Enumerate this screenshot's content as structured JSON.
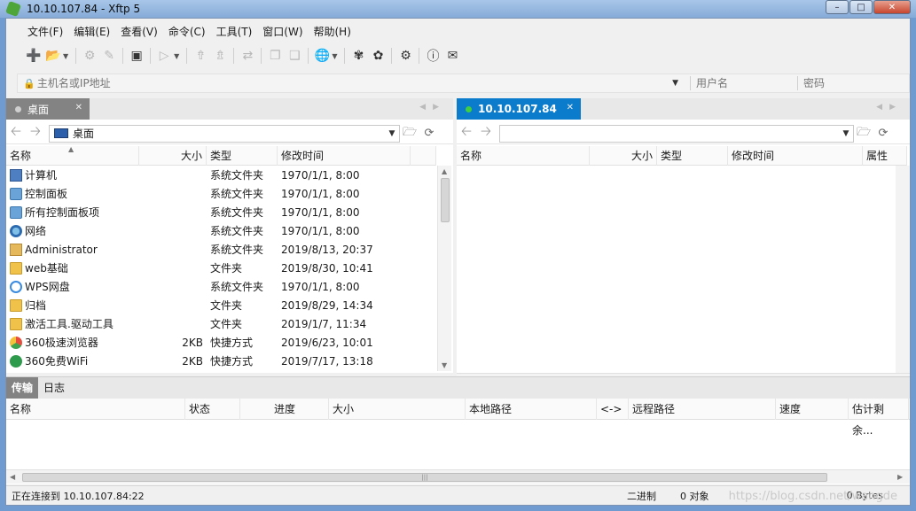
{
  "window": {
    "title": "10.10.107.84   - Xftp 5"
  },
  "menu": [
    "文件(F)",
    "编辑(E)",
    "查看(V)",
    "命令(C)",
    "工具(T)",
    "窗口(W)",
    "帮助(H)"
  ],
  "address": {
    "host_placeholder": "主机名或IP地址",
    "user_placeholder": "用户名",
    "password_placeholder": "密码"
  },
  "left_pane": {
    "tab_label": "桌面",
    "path": "桌面",
    "columns": {
      "name": "名称",
      "size": "大小",
      "type": "类型",
      "modified": "修改时间"
    },
    "rows": [
      {
        "name": "计算机",
        "size": "",
        "type": "系统文件夹",
        "modified": "1970/1/1, 8:00",
        "icon": "computer-icon"
      },
      {
        "name": "控制面板",
        "size": "",
        "type": "系统文件夹",
        "modified": "1970/1/1, 8:00",
        "icon": "control-panel-icon"
      },
      {
        "name": "所有控制面板项",
        "size": "",
        "type": "系统文件夹",
        "modified": "1970/1/1, 8:00",
        "icon": "control-panel-icon"
      },
      {
        "name": "网络",
        "size": "",
        "type": "系统文件夹",
        "modified": "1970/1/1, 8:00",
        "icon": "network-icon"
      },
      {
        "name": "Administrator",
        "size": "",
        "type": "系统文件夹",
        "modified": "2019/8/13, 20:37",
        "icon": "user-folder-icon"
      },
      {
        "name": "web基础",
        "size": "",
        "type": "文件夹",
        "modified": "2019/8/30, 10:41",
        "icon": "folder-icon"
      },
      {
        "name": "WPS网盘",
        "size": "",
        "type": "系统文件夹",
        "modified": "1970/1/1, 8:00",
        "icon": "cloud-icon"
      },
      {
        "name": "归档",
        "size": "",
        "type": "文件夹",
        "modified": "2019/8/29, 14:34",
        "icon": "folder-icon"
      },
      {
        "name": "激活工具.驱动工具",
        "size": "",
        "type": "文件夹",
        "modified": "2019/1/7, 11:34",
        "icon": "folder-icon"
      },
      {
        "name": "360极速浏览器",
        "size": "2KB",
        "type": "快捷方式",
        "modified": "2019/6/23, 10:01",
        "icon": "browser-icon"
      },
      {
        "name": "360免费WiFi",
        "size": "2KB",
        "type": "快捷方式",
        "modified": "2019/7/17, 13:18",
        "icon": "wifi-icon"
      }
    ]
  },
  "right_pane": {
    "tab_label": "10.10.107.84",
    "path": "",
    "columns": {
      "name": "名称",
      "size": "大小",
      "type": "类型",
      "modified": "修改时间",
      "attributes": "属性"
    }
  },
  "transfer": {
    "tabs": [
      "传输",
      "日志"
    ],
    "columns": [
      "名称",
      "状态",
      "进度",
      "大小",
      "本地路径",
      "<->",
      "远程路径",
      "速度",
      "估计剩余..."
    ]
  },
  "status": {
    "message": "正在连接到 10.10.107.84:22",
    "mode": "二进制",
    "objects": "0 对象",
    "bytes": "0 Bytes",
    "watermark": "https://blog.csdn.net/wangde"
  },
  "colors": {
    "remote_tab": "#0b7ccc",
    "local_tab": "#838383",
    "connected_dot": "#3fcf3f"
  }
}
